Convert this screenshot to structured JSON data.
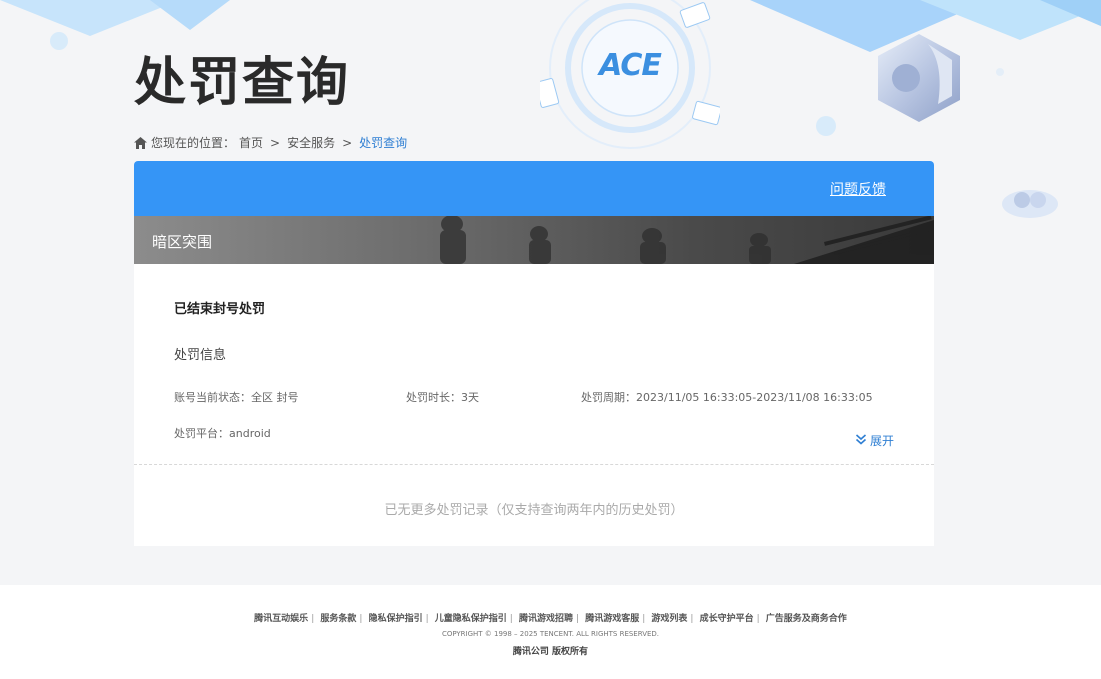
{
  "header": {
    "title": "处罚查询",
    "logo_text": "ACE"
  },
  "breadcrumb": {
    "prefix": "您现在的位置：",
    "items": [
      "首页",
      "安全服务",
      "处罚查询"
    ]
  },
  "card": {
    "feedback_label": "问题反馈",
    "game_name": "暗区突围",
    "record": {
      "title": "已结束封号处罚",
      "section_label": "处罚信息",
      "account_status": "账号当前状态：全区 封号",
      "duration": "处罚时长：3天",
      "period": "处罚周期：2023/11/05 16:33:05-2023/11/08 16:33:05",
      "platform": "处罚平台：android",
      "expand_label": "展开"
    },
    "no_more": "已无更多处罚记录（仅支持查询两年内的历史处罚）"
  },
  "footer": {
    "links": [
      "腾讯互动娱乐",
      "服务条款",
      "隐私保护指引",
      "儿童隐私保护指引",
      "腾讯游戏招聘",
      "腾讯游戏客服",
      "游戏列表",
      "成长守护平台",
      "广告服务及商务合作"
    ],
    "copyright": "COPYRIGHT © 1998 – 2025 TENCENT. ALL RIGHTS RESERVED.",
    "rights": "腾讯公司 版权所有"
  },
  "colors": {
    "accent": "#3595f6",
    "link": "#2f7fd3"
  }
}
